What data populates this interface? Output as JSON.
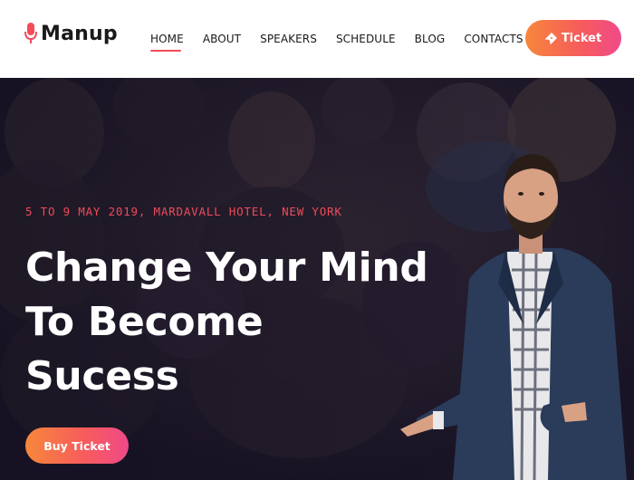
{
  "header": {
    "logo_text": "Manup",
    "nav": [
      {
        "label": "HOME",
        "active": true
      },
      {
        "label": "ABOUT"
      },
      {
        "label": "SPEAKERS"
      },
      {
        "label": "SCHEDULE"
      },
      {
        "label": "BLOG"
      },
      {
        "label": "CONTACTS"
      }
    ],
    "ticket_label": "Ticket",
    "ticket_icon": "ticket-icon",
    "logo_icon": "microphone-icon"
  },
  "hero": {
    "event_info": "5 TO 9 MAY 2019, MARDAVALL HOTEL, NEW YORK",
    "headline": [
      "Change Your Mind",
      "To Become",
      "Sucess"
    ],
    "buy_label": "Buy Ticket"
  },
  "colors": {
    "accent": "#f24c59",
    "gradient_start": "#f7873b",
    "gradient_end": "#ef4a89",
    "hero_bg": "#1c1729"
  }
}
